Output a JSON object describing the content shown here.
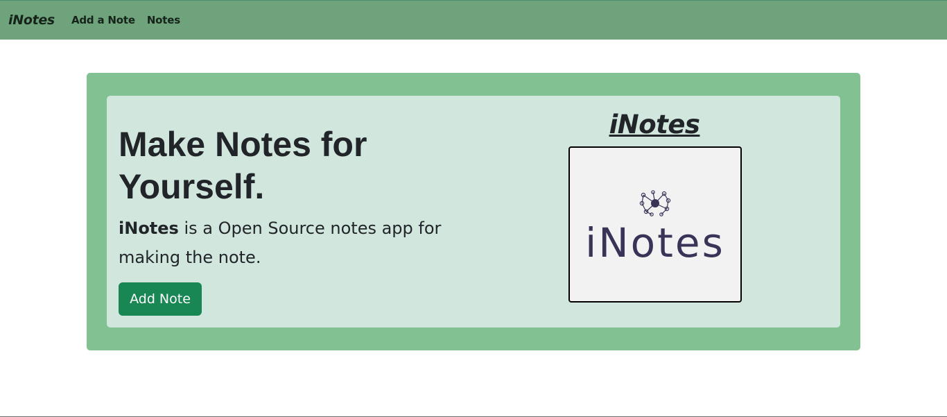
{
  "navbar": {
    "brand": "iNotes",
    "links": [
      "Add a Note",
      "Notes"
    ]
  },
  "hero": {
    "headline": "Make Notes for Yourself.",
    "lead_strong": "iNotes",
    "lead_rest": " is a Open Source notes app for making the note.",
    "button_label": "Add Note",
    "logo_title": "iNotes",
    "logo_image_text": "iNotes"
  },
  "colors": {
    "navbar": "#6fa37b",
    "outer_panel": "#81c192",
    "inner_panel": "#d1e7dd",
    "button": "#198754",
    "logo_ink": "#3a3358"
  }
}
